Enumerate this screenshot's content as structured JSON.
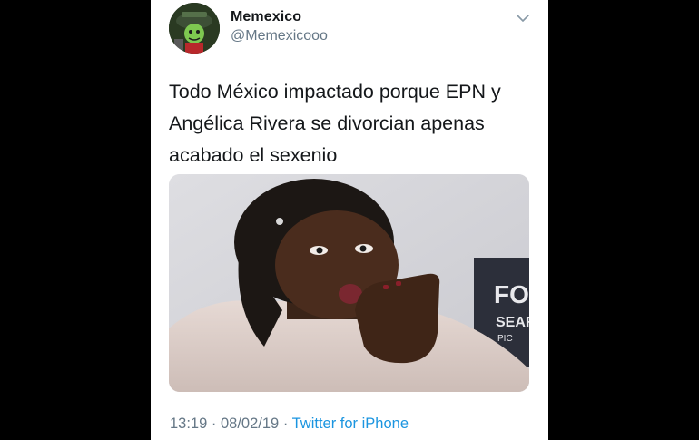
{
  "tweet": {
    "display_name": "Memexico",
    "handle": "@Memexicooo",
    "text_lines": [
      "Todo México impactado porque EPN y",
      "Angélica Rivera se divorcian apenas",
      "acabado el sexenio"
    ],
    "time": "13:19",
    "separator": "·",
    "date": "08/02/19",
    "source": "Twitter for iPhone"
  },
  "media": {
    "backdrop_text_1": "FO",
    "backdrop_text_2": "SEAR",
    "backdrop_text_3": "PIC"
  },
  "icons": {
    "avatar": "avatar-cartoon-icon",
    "menu": "chevron-down-icon"
  },
  "colors": {
    "name": "#14171a",
    "secondary": "#657786",
    "link": "#1b95e0"
  }
}
